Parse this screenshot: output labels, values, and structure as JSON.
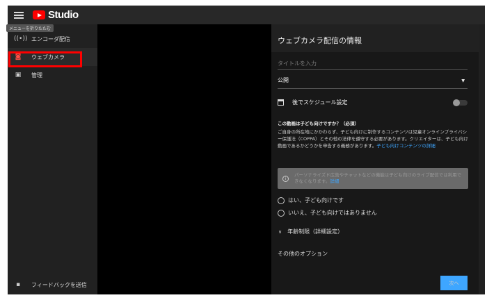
{
  "header": {
    "logo_text": "Studio",
    "menu_tooltip": "メニューを折りたたむ"
  },
  "sidebar": {
    "items": [
      {
        "label": "エンコーダ配信",
        "icon": "broadcast-icon"
      },
      {
        "label": "ウェブカメラ",
        "icon": "camera-icon",
        "active": true
      },
      {
        "label": "管理",
        "icon": "calendar-icon"
      }
    ],
    "feedback": "フィードバックを送信"
  },
  "panel": {
    "title": "ウェブカメラ配信の情報",
    "title_placeholder": "タイトルを入力",
    "visibility": "公開",
    "schedule_label": "後でスケジュール設定",
    "schedule_on": false,
    "kids_question": "この動画は子ども向けですか？（必須）",
    "kids_desc": "ご自身の所在地にかかわらず、子ども向けに制作するコンテンツは児童オンラインプライバシー保護法（COPPA）とその他の法律を遵守する必要があります。クリエイターは、子ども向け動画であるかどうかを申告する義務があります。",
    "kids_link": "子ども向けコンテンツの詳細",
    "notice": "パーソナライズド広告やチャットなどの機能は子ども向けのライブ配信では利用できなくなります。",
    "notice_link": "詳細",
    "radio_yes": "はい、子ども向けです",
    "radio_no": "いいえ、子ども向けではありません",
    "age": "年齢制限（詳細設定）",
    "other": "その他のオプション",
    "next": "次へ"
  },
  "colors": {
    "accent": "#3ea6ff",
    "highlight": "#ff0000",
    "brand": "#ff0000"
  }
}
